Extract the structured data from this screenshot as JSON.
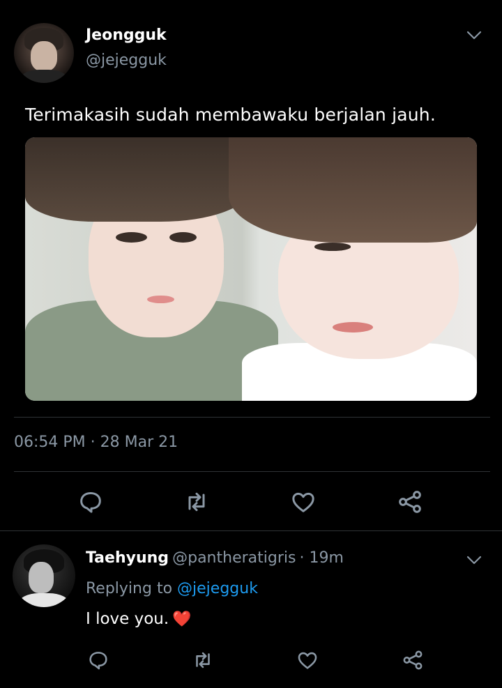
{
  "tweet": {
    "author_name": "Jeongguk",
    "author_handle": "@jejegguk",
    "text": "Terimakasih sudah membawaku berjalan jauh.",
    "timestamp": "06:54 PM · 28 Mar 21",
    "actions": [
      "reply-icon",
      "retweet-icon",
      "like-icon",
      "share-icon"
    ]
  },
  "reply": {
    "author_name": "Taehyung",
    "author_handle": "@pantheratigris",
    "time": "· 19m",
    "replying_to_label": "Replying to",
    "replying_to_handle": "@jejegguk",
    "text": "I love you.",
    "emoji": "❤️",
    "actions": [
      "reply-icon",
      "retweet-icon",
      "like-icon",
      "share-icon"
    ]
  },
  "colors": {
    "background": "#000000",
    "text": "#ffffff",
    "secondary_text": "#8b98a5",
    "link": "#1d9bf0",
    "divider": "#2f3336"
  }
}
